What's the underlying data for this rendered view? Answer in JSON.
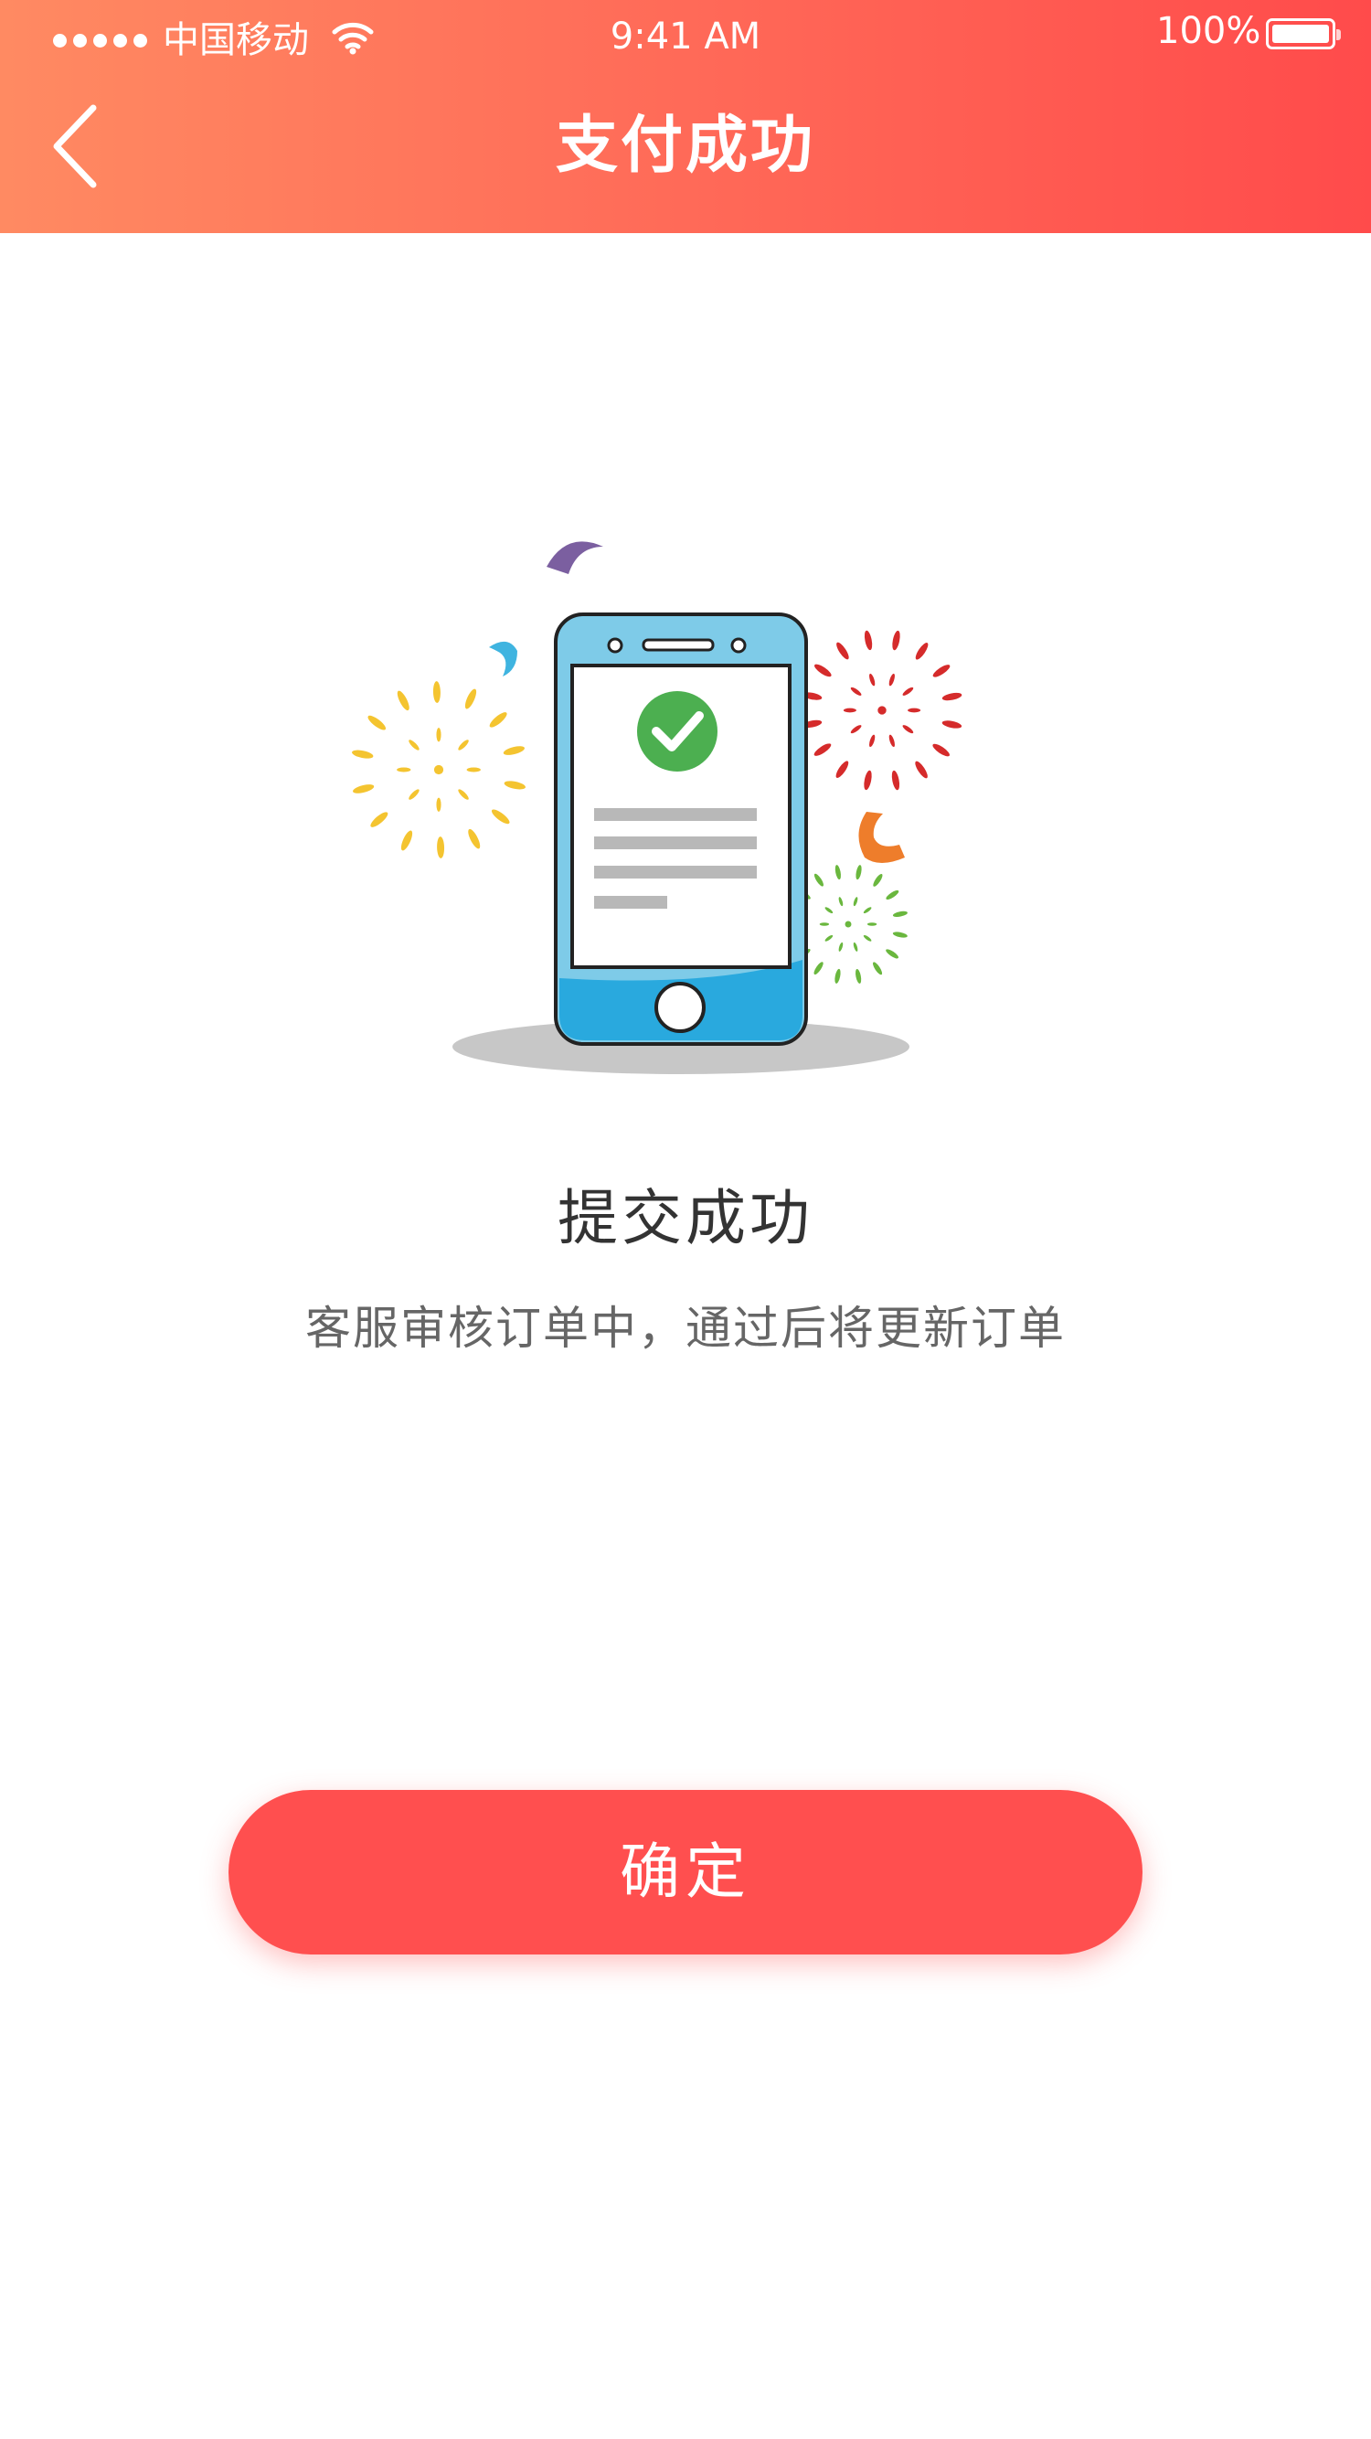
{
  "status_bar": {
    "carrier": "中国移动",
    "time": "9:41 AM",
    "battery": "100%",
    "signal_bars": 5,
    "battery_level": 1.0
  },
  "nav": {
    "title": "支付成功",
    "back_icon": "chevron-left-icon"
  },
  "result": {
    "title": "提交成功",
    "description": "客服审核订单中，通过后将更新订单",
    "icon": "check-circle-icon"
  },
  "actions": {
    "confirm_label": "确定"
  },
  "colors": {
    "header_gradient_start": "#ff8a62",
    "header_gradient_end": "#ff4b4b",
    "primary": "#ff4f4f",
    "success": "#4caf50",
    "phone_body": "#7ecbe8",
    "title_text": "#333333",
    "desc_text": "#666666"
  }
}
